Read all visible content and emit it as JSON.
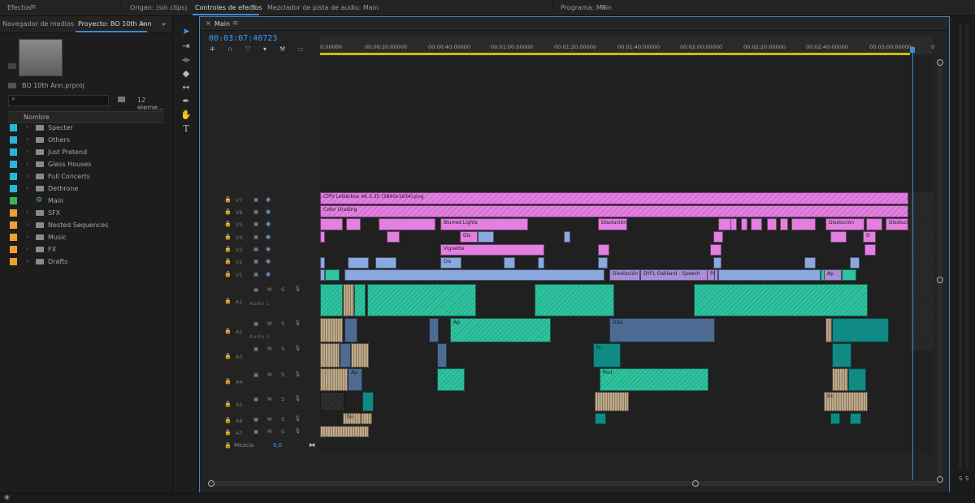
{
  "top_tabs": {
    "effects": "Efectos",
    "source": "Origen: (sin clips)",
    "effect_controls": "Controles de efectos",
    "audio_mixer": "Mezclador de pista de audio: Main",
    "program": "Programa: Main"
  },
  "project_panel": {
    "tab_media_browser": "Navegador de medios",
    "tab_project": "Proyecto: BO 10th Ann",
    "project_file": "BO 10th Ann.prproj",
    "item_count": "12 eleme...",
    "column_name": "Nombre",
    "items": [
      {
        "label": "Specter",
        "color": "#29b6d6",
        "type": "folder"
      },
      {
        "label": "Others",
        "color": "#29b6d6",
        "type": "folder"
      },
      {
        "label": "Just Pretend",
        "color": "#29b6d6",
        "type": "folder"
      },
      {
        "label": "Glass Houses",
        "color": "#29b6d6",
        "type": "folder"
      },
      {
        "label": "Full Concerts",
        "color": "#29b6d6",
        "type": "folder"
      },
      {
        "label": "Dethrone",
        "color": "#29b6d6",
        "type": "folder"
      },
      {
        "label": "Main",
        "color": "#3fb34f",
        "type": "sequence"
      },
      {
        "label": "SFX",
        "color": "#f0a030",
        "type": "folder"
      },
      {
        "label": "Nested Sequences",
        "color": "#f0a030",
        "type": "folder"
      },
      {
        "label": "Music",
        "color": "#f0a030",
        "type": "folder"
      },
      {
        "label": "FX",
        "color": "#f0a030",
        "type": "folder"
      },
      {
        "label": "Drafts",
        "color": "#f0a030",
        "type": "folder"
      }
    ]
  },
  "timeline": {
    "sequence_name": "Main",
    "timecode": "00:03:07:40723",
    "ruler_ticks": [
      "0:00000",
      "00:00:20:00000",
      "00:00:40:00000",
      "00:01:00:00000",
      "00:01:20:00000",
      "00:01:40:00000",
      "00:02:00:00000",
      "00:02:20:00000",
      "00:02:40:00000",
      "00:03:00:00000",
      "0"
    ],
    "video_tracks": [
      "V7",
      "V6",
      "V5",
      "V4",
      "V3",
      "V2",
      "V1"
    ],
    "audio_tracks": [
      "A1",
      "A2",
      "A3",
      "A4",
      "A5",
      "A6",
      "A7"
    ],
    "audio_track_names": {
      "a1": "Audio 1",
      "a2": "Audio 2"
    },
    "mix_label": "Mezcla",
    "mix_value": "0,0",
    "clip_labels": {
      "letterbox": "LTPV Letterbox 4K 2.35 (3840x1634).png",
      "color_grading": "Color Grading",
      "blurred_lights": "Blurred Lights",
      "vignette": "Vignette",
      "disolucion": "Disolución",
      "disolucion_mu": "Disolución mu",
      "dyfl": "DYFL Oakland - Speech",
      "dis": "Dis",
      "pip": "Pip",
      "ap": "Ap",
      "fx": "fx",
      "dissolve_short": "Diss",
      "port": "Port",
      "tinta": "Tin",
      "ex": "Ex",
      "d": "D"
    }
  },
  "meter": {
    "s1": "S",
    "s2": "S"
  }
}
